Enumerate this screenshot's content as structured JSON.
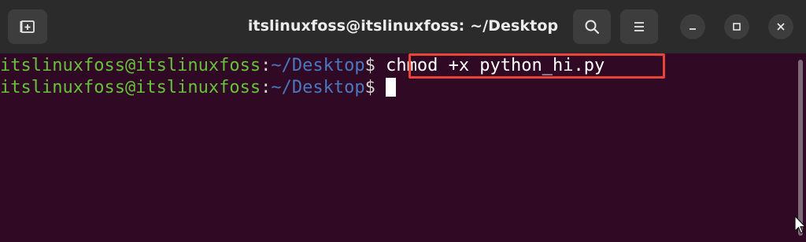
{
  "window": {
    "title": "itslinuxfoss@itslinuxfoss: ~/Desktop"
  },
  "titlebar": {
    "new_tab_icon": "new-tab-icon",
    "search_icon": "search-icon",
    "menu_icon": "hamburger-menu-icon",
    "minimize_icon": "minimize-icon",
    "maximize_icon": "maximize-icon",
    "close_icon": "close-icon"
  },
  "terminal": {
    "lines": [
      {
        "user": "itslinuxfoss@itslinuxfoss",
        "colon": ":",
        "path": "~/Desktop",
        "dollar": "$",
        "command": " chmod +x python_hi.py"
      },
      {
        "user": "itslinuxfoss@itslinuxfoss",
        "colon": ":",
        "path": "~/Desktop",
        "dollar": "$",
        "command": " "
      }
    ]
  },
  "colors": {
    "terminal_bg": "#300a24",
    "titlebar_bg": "#2b2b2b",
    "user_green": "#66c23a",
    "path_blue": "#4a78c2",
    "highlight_red": "#e94437"
  }
}
